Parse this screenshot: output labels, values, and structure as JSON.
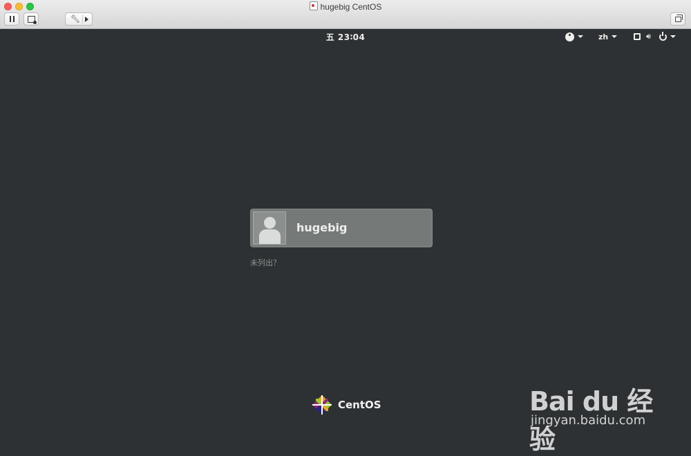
{
  "window": {
    "title": "hugebig CentOS",
    "toolbar": {
      "pause": "pause-icon",
      "snapshot": "snapshot-icon",
      "settings": "wrench-icon",
      "window_mode": "window-icon"
    }
  },
  "topbar": {
    "clock": "五 23∶04",
    "language": "zh",
    "icons": [
      "accessibility-icon",
      "network-icon",
      "volume-icon",
      "power-icon"
    ]
  },
  "login": {
    "username": "hugebig",
    "not_listed": "未列出？"
  },
  "branding": {
    "os_name": "CentOS"
  },
  "watermark": {
    "brand": "Bai du 经验",
    "url": "jingyan.baidu.com"
  },
  "colors": {
    "background": "#2d3133",
    "user_card": "#757a79",
    "text": "#eeeeec"
  }
}
